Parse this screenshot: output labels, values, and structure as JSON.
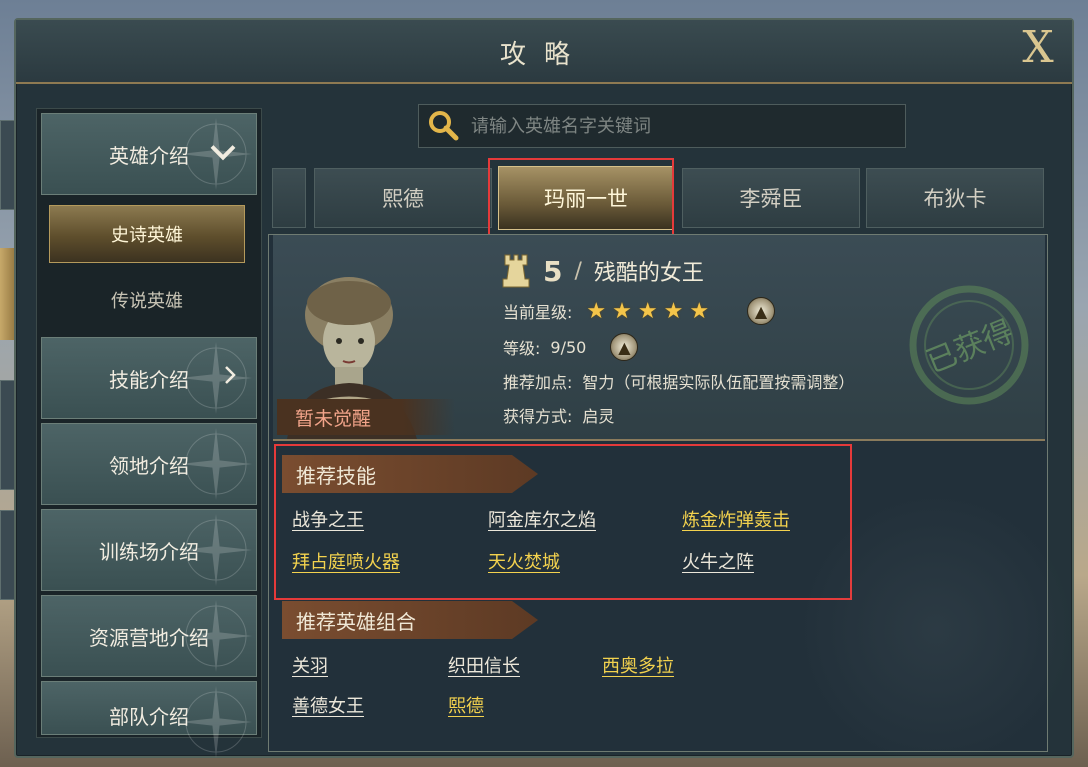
{
  "window": {
    "title": "攻略",
    "close_label": "X"
  },
  "sidebar": {
    "items": [
      {
        "label": "英雄介绍",
        "chevron": "chevron-down"
      },
      {
        "label": "技能介绍",
        "chevron": "chevron-right"
      },
      {
        "label": "领地介绍"
      },
      {
        "label": "训练场介绍"
      },
      {
        "label": "资源营地介绍"
      },
      {
        "label": "部队介绍"
      }
    ],
    "sub_items": [
      {
        "label": "史诗英雄",
        "active": true
      },
      {
        "label": "传说英雄",
        "active": false
      }
    ]
  },
  "search": {
    "placeholder": "请输入英雄名字关键词",
    "icon": "search-icon"
  },
  "tabs": [
    "熙德",
    "玛丽一世",
    "李舜臣",
    "布狄卡"
  ],
  "active_tab": "玛丽一世",
  "hero": {
    "tier": "5",
    "separator": "/",
    "title": "残酷的女王",
    "star_label": "当前星级:",
    "stars": 5,
    "level_label": "等级:",
    "level_value": "9/50",
    "points_label": "推荐加点:",
    "points_value": "智力（可根据实际队伍配置按需调整）",
    "obtain_label": "获得方式:",
    "obtain_value": "启灵",
    "awaken_status": "暂未觉醒",
    "stamp_text": "已获得"
  },
  "skills": {
    "header": "推荐技能",
    "items": [
      {
        "name": "战争之王",
        "color": "white"
      },
      {
        "name": "阿金库尔之焰",
        "color": "white"
      },
      {
        "name": "炼金炸弹轰击",
        "color": "gold"
      },
      {
        "name": "拜占庭喷火器",
        "color": "gold"
      },
      {
        "name": "天火焚城",
        "color": "gold"
      },
      {
        "name": "火牛之阵",
        "color": "white"
      }
    ]
  },
  "combos": {
    "header": "推荐英雄组合",
    "items": [
      {
        "name": "关羽",
        "color": "white"
      },
      {
        "name": "织田信长",
        "color": "white"
      },
      {
        "name": "西奥多拉",
        "color": "gold"
      },
      {
        "name": "善德女王",
        "color": "white"
      },
      {
        "name": "熙德",
        "color": "gold"
      }
    ]
  },
  "colors": {
    "gold_text": "#f3d24e",
    "highlight_box": "#e53a3a",
    "accent_brown": "#7a4d30"
  }
}
